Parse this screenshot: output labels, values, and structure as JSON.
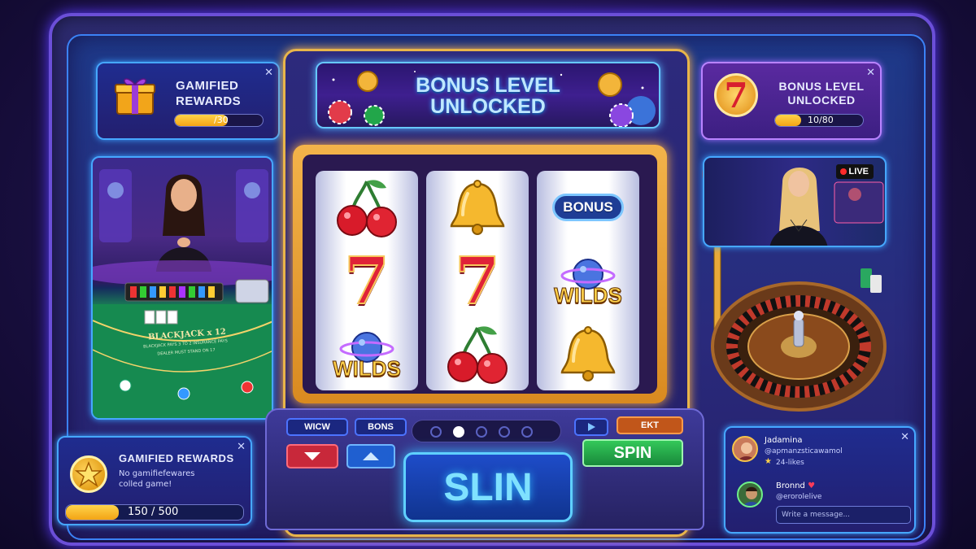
{
  "rewards_top": {
    "title_line1": "GAMIFIED",
    "title_line2": "REWARDS",
    "progress_text": "/30",
    "progress_fraction": 0.6
  },
  "rewards_bottom": {
    "title": "GAMIFIED REWARDS",
    "subtitle_line1": "No gamifiefewares",
    "subtitle_line2": "colled game!",
    "progress_text": "150 / 500",
    "progress_fraction": 0.3
  },
  "banner": {
    "line1": "BONUS LEVEL",
    "line2": "UNLOCKED"
  },
  "bonus_right": {
    "title_line1": "BONUS LEVEL",
    "title_line2": "UNLOCKED",
    "progress_text": "10/80",
    "progress_fraction": 0.3
  },
  "blackjack": {
    "table_text": "BLACKJACK x 12",
    "table_line2": "BLACKJACK PAYS 3 TO 2 INSURANCE PAYS",
    "table_line3": "DEALER MUST STAND ON 17"
  },
  "reels": [
    [
      "cherry",
      "seven",
      "wilds"
    ],
    [
      "bell",
      "seven",
      "cherry"
    ],
    [
      "bonus",
      "wilds",
      "bell"
    ]
  ],
  "symbols": {
    "wilds": "WILDS",
    "bonus": "BONUS",
    "seven": "7"
  },
  "controls": {
    "btn1": "WICW",
    "btn2": "BONS",
    "btn3": "EKT",
    "spin_small": "SPIN",
    "spin_big": "SLIN"
  },
  "live": {
    "badge": "LIVE"
  },
  "chat": {
    "user1": {
      "name": "Jadamina",
      "handle": "@apmanzsticawamol",
      "likes": "24-likes"
    },
    "user2": {
      "name": "Bronnd",
      "handle": "@erorolelive"
    },
    "input_placeholder": "Write a message..."
  },
  "close_glyph": "✕",
  "colors": {
    "accent_blue": "#46a7ff",
    "gold": "#f3b34a",
    "spin_green": "#22a64a"
  }
}
